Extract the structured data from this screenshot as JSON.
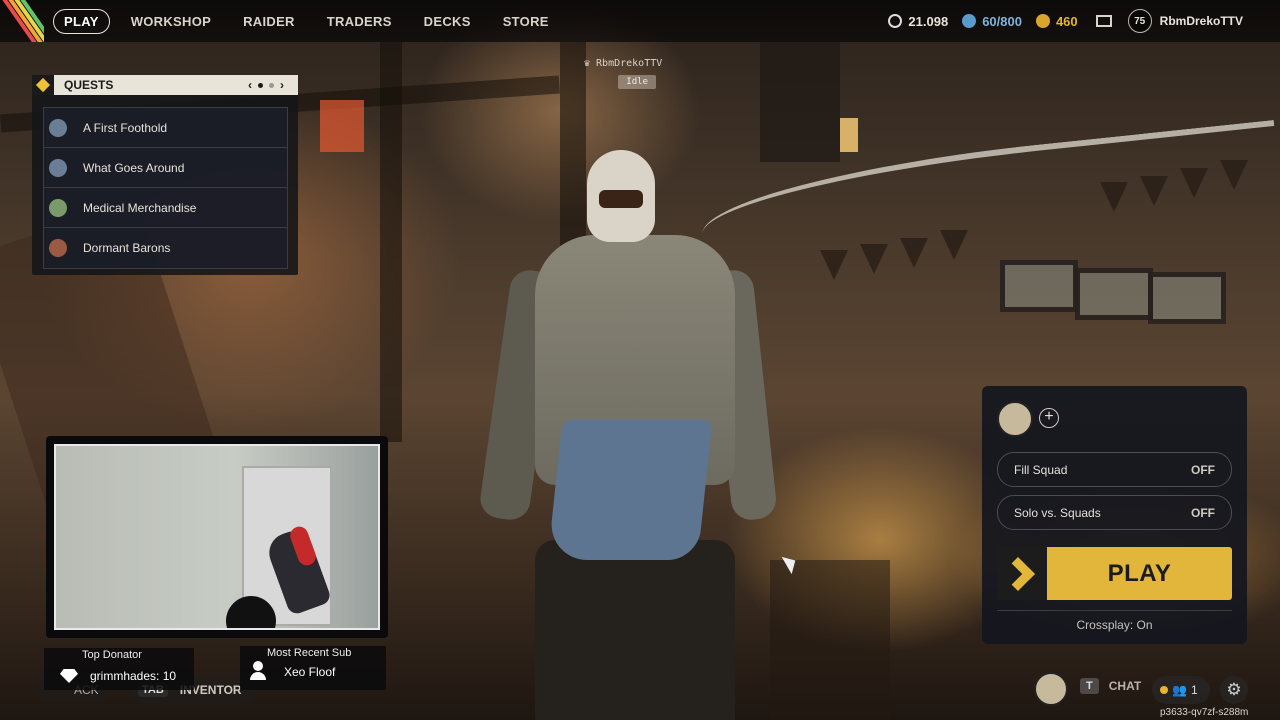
{
  "nav": {
    "items": [
      "PLAY",
      "WORKSHOP",
      "RAIDER",
      "TRADERS",
      "DECKS",
      "STORE"
    ],
    "active": "PLAY"
  },
  "currencies": {
    "credits": "21.098",
    "raider_tokens": "60/800",
    "coins": "460"
  },
  "profile": {
    "level": "75",
    "name": "RbmDrekoTTV"
  },
  "quests": {
    "title": "QUESTS",
    "items": [
      {
        "label": "A First Foothold",
        "icon": "quest-trader-icon"
      },
      {
        "label": "What Goes Around",
        "icon": "quest-trader-icon"
      },
      {
        "label": "Medical Merchandise",
        "icon": "quest-medic-icon"
      },
      {
        "label": "Dormant Barons",
        "icon": "quest-baron-icon"
      }
    ]
  },
  "party_tag": {
    "name": "RbmDrekoTTV",
    "status": "Idle"
  },
  "stream_overlay": {
    "top_donator_label": "Top Donator",
    "top_donator_value": "grimmhades: 10",
    "recent_sub_label": "Most Recent Sub",
    "recent_sub_value": "Xeo Floof"
  },
  "bottom_left": {
    "back_text": "ACK",
    "inventory_key": "TAB",
    "inventory_label": "INVENTOR"
  },
  "play_panel": {
    "add_icon": "+",
    "fill_squad_label": "Fill Squad",
    "fill_squad_state": "OFF",
    "solo_label": "Solo vs. Squads",
    "solo_state": "OFF",
    "play_label": "PLAY",
    "crossplay": "Crossplay: On"
  },
  "bottom_right": {
    "chat_key": "T",
    "chat_label": "CHAT",
    "friends_count": "1",
    "session_id": "p3633-qv7zf-s288m"
  },
  "colors": {
    "accent": "#e2b63a",
    "panel": "#14161e",
    "text": "#e8e4dc"
  }
}
